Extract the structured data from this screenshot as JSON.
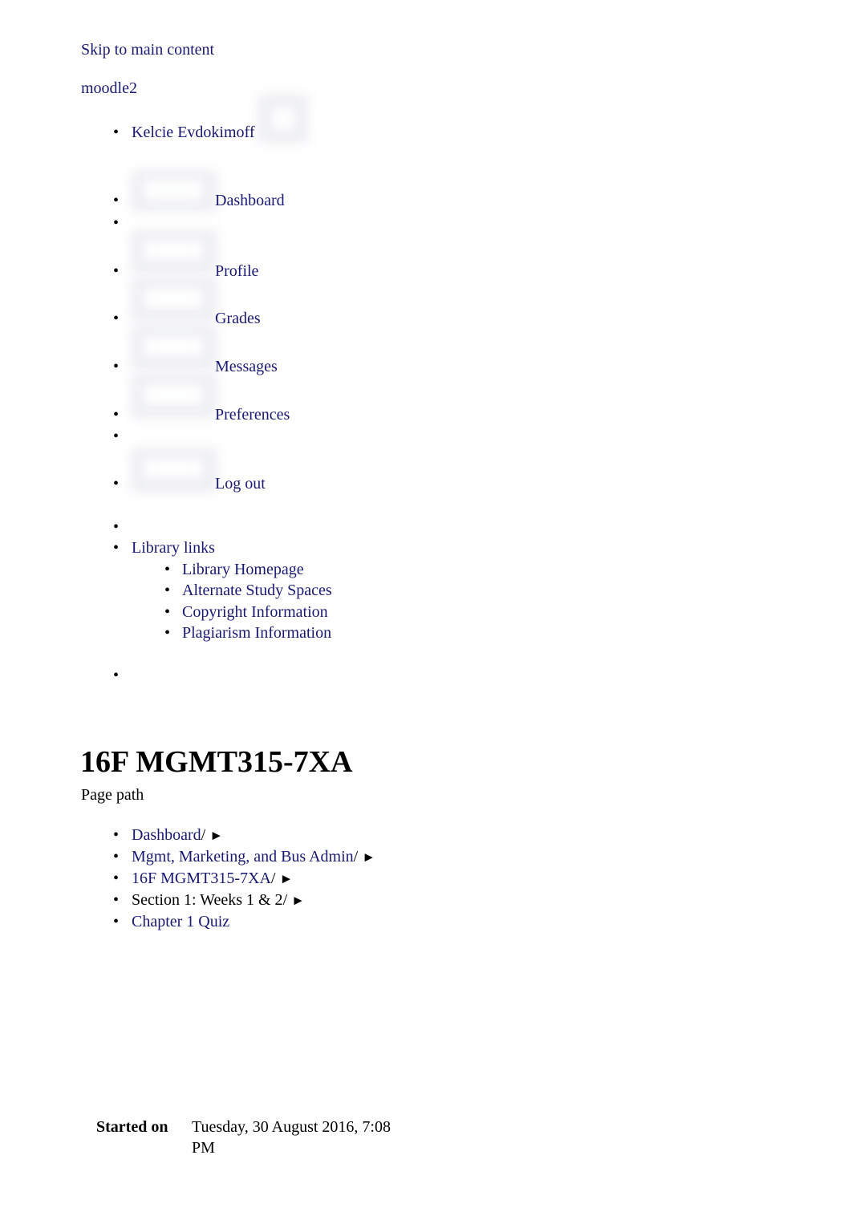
{
  "header": {
    "skip_link": "Skip to main content",
    "site_name": "moodle2"
  },
  "user_menu": {
    "user_name": "Kelcie Evdokimoff",
    "items": [
      {
        "label": "Dashboard",
        "icon": "dashboard-icon"
      },
      {
        "label": "",
        "icon": ""
      },
      {
        "label": "Profile",
        "icon": "profile-icon"
      },
      {
        "label": "Grades",
        "icon": "grades-icon"
      },
      {
        "label": "Messages",
        "icon": "messages-icon"
      },
      {
        "label": "Preferences",
        "icon": "preferences-icon"
      },
      {
        "label": "",
        "icon": ""
      },
      {
        "label": "Log out",
        "icon": "logout-icon"
      }
    ]
  },
  "library": {
    "heading": "Library links",
    "links": [
      "Library Homepage",
      "Alternate Study Spaces",
      "Copyright Information",
      "Plagiarism Information"
    ]
  },
  "main": {
    "course_title": "16F MGMT315-7XA",
    "page_path_label": "Page path"
  },
  "breadcrumb": {
    "separator": "/",
    "arrow": "►",
    "items": [
      {
        "label": "Dashboard",
        "is_link": true,
        "has_sep": true
      },
      {
        "label": "Mgmt, Marketing, and Bus Admin",
        "is_link": true,
        "has_sep": true
      },
      {
        "label": "16F MGMT315-7XA",
        "is_link": true,
        "has_sep": true
      },
      {
        "label": "Section 1: Weeks 1 & 2",
        "is_link": false,
        "has_sep": true
      },
      {
        "label": "Chapter 1 Quiz",
        "is_link": true,
        "has_sep": false
      }
    ]
  },
  "quiz_info": {
    "started_on_label": "Started on",
    "started_on_value": "Tuesday, 30 August 2016, 7:08 PM"
  },
  "colors": {
    "link": "#191970",
    "text": "#000000",
    "background": "#ffffff",
    "placeholder": "#e9eaee"
  },
  "glyphs": {
    "bullet": "•"
  }
}
